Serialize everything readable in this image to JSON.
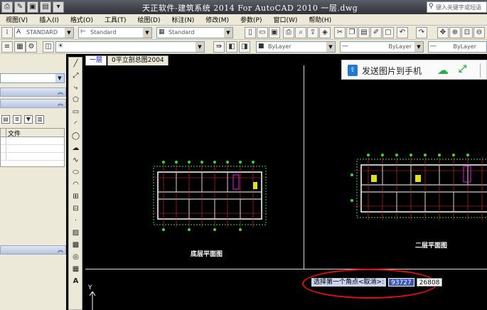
{
  "window": {
    "title": "天正软件-建筑系统 2014  For AutoCAD 2010  一层.dwg",
    "help_search_placeholder": "键入关键字或短语"
  },
  "menu": [
    "视图(V)",
    "插入(I)",
    "格式(O)",
    "工具(T)",
    "绘图(D)",
    "标注(N)",
    "修改(M)",
    "参数(P)",
    "窗口(W)",
    "帮助(H)"
  ],
  "toolbar": {
    "text_style": "STANDARD",
    "dim_style": "Standard",
    "table_style": "Standard",
    "layer_color": "ByLayer",
    "linetype": "ByLayer",
    "lineweight": "ByLayer"
  },
  "left_panel": {
    "column_header": "文件"
  },
  "tabs": [
    {
      "label": "一层",
      "active": true
    },
    {
      "label": "0平立剖总图2004",
      "active": false
    }
  ],
  "send_to_phone": {
    "label": "发送图片到手机"
  },
  "drawing": {
    "plan1_label": "底层平面图",
    "plan2_label": "二层平面图"
  },
  "command": {
    "prompt": "选择第一个角点<取消>:",
    "x_value": "93727",
    "y_value": "26808"
  },
  "ucs_label": "Y",
  "colors": {
    "canvas_bg": "#000000",
    "wall": "#ffffff",
    "grid_axis": "#e03030",
    "dimension": "#30e030",
    "highlight": "#e020e0",
    "annotation_red": "#e01010"
  }
}
